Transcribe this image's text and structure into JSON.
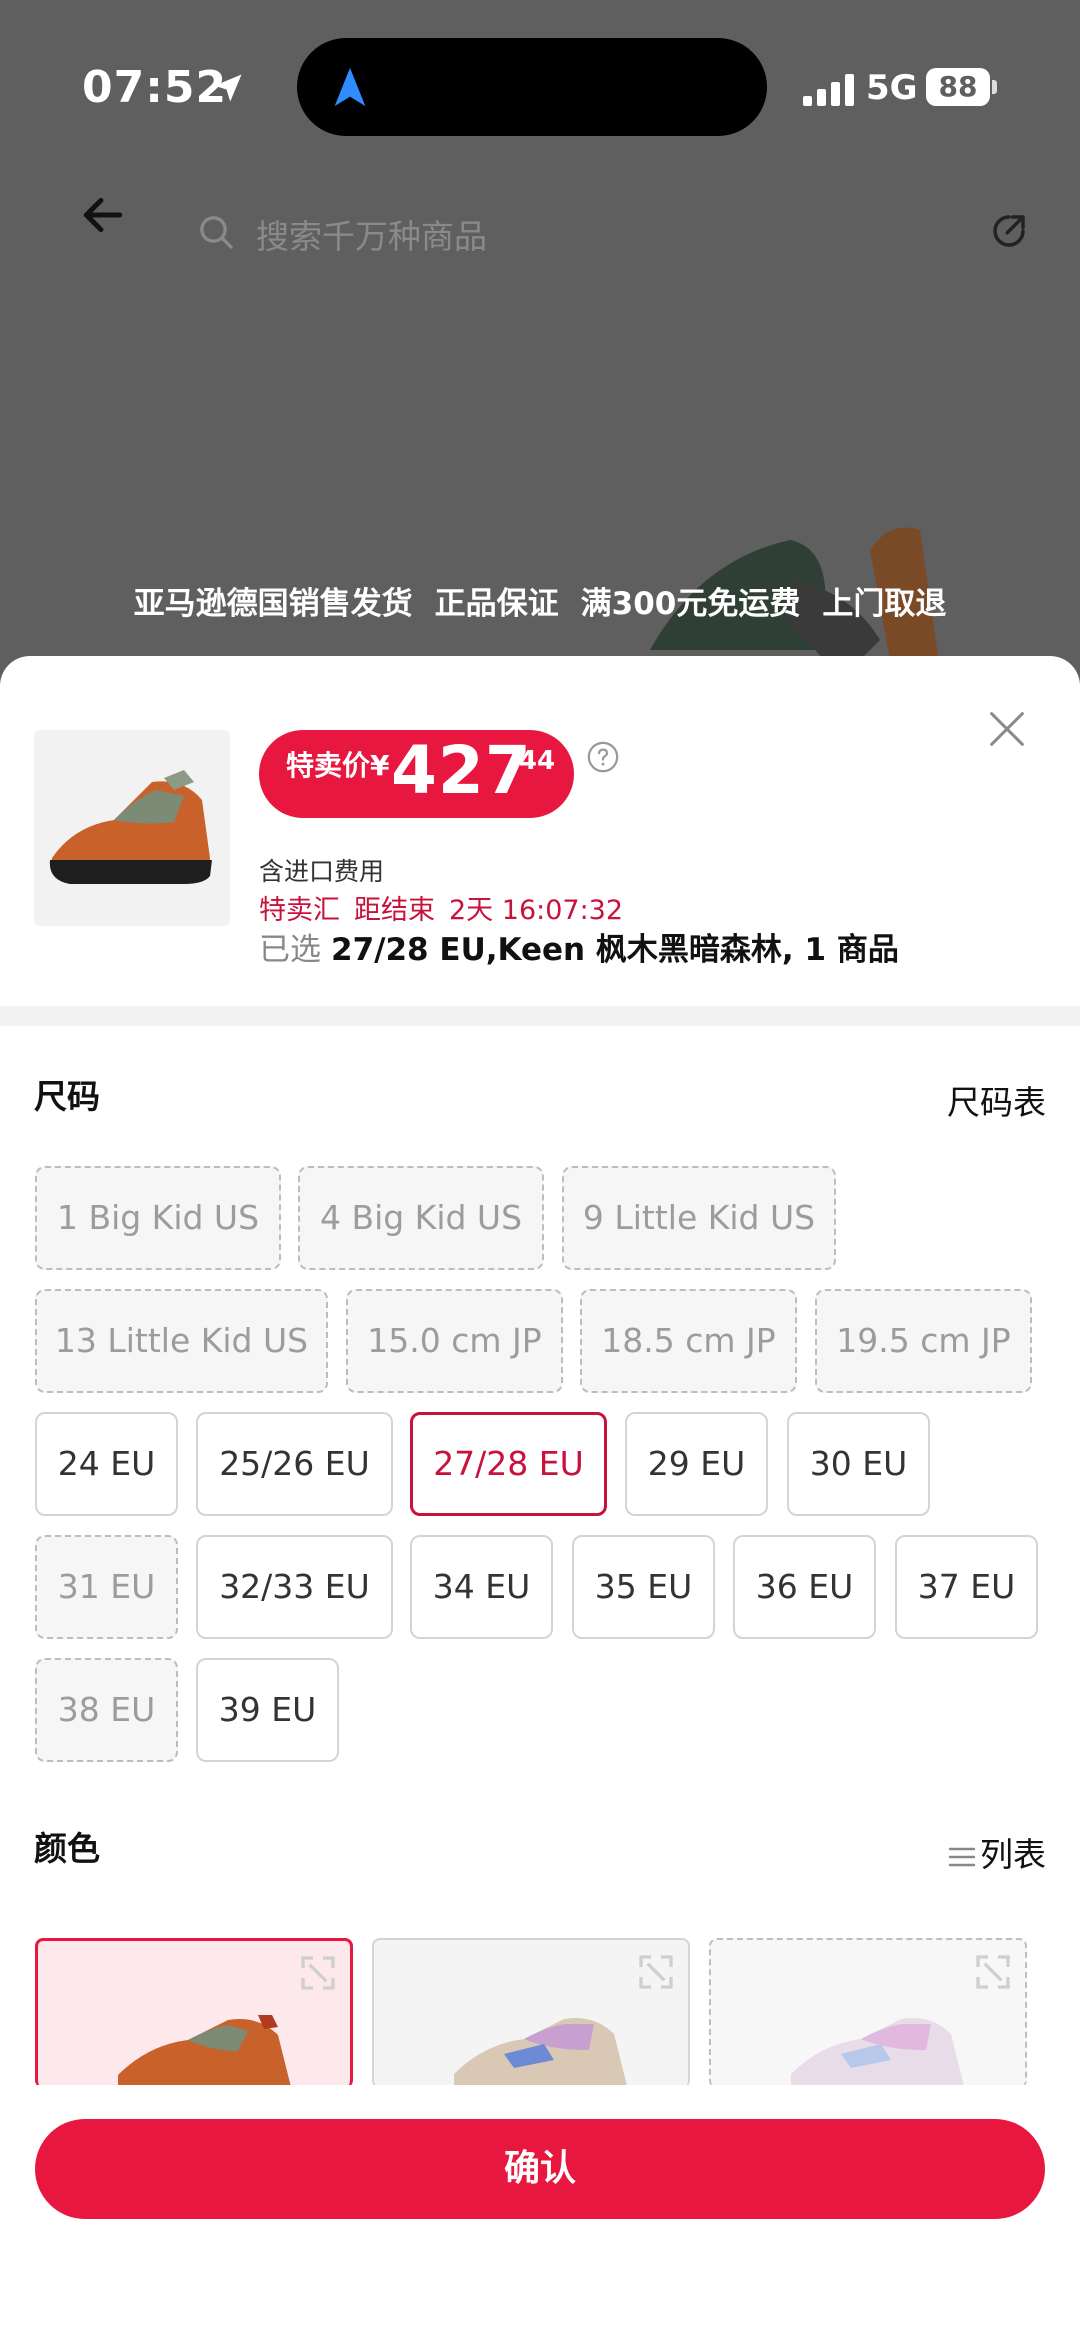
{
  "status_bar": {
    "time": "07:52",
    "network": "5G",
    "battery": "88"
  },
  "header": {
    "search_placeholder": "搜索千万种商品"
  },
  "service_badges": [
    "亚马逊德国销售发货",
    "正品保证",
    "满300元免运费",
    "上门取退"
  ],
  "product": {
    "price_label": "特卖价¥",
    "price_int": "427",
    "price_dec": ".44",
    "import_fee": "含进口费用",
    "deal_name": "特卖汇",
    "deal_countdown_label": "距结束",
    "deal_countdown": "2天 16:07:32",
    "selected_prefix": "已选",
    "selected_value": "27/28 EU,Keen 枫木黑暗森林, 1 商品"
  },
  "size_section": {
    "title": "尺码",
    "chart_link": "尺码表",
    "sizes": [
      {
        "label": "1 Big Kid US",
        "state": "unavailable"
      },
      {
        "label": "4 Big Kid US",
        "state": "unavailable"
      },
      {
        "label": "9 Little Kid US",
        "state": "unavailable"
      },
      {
        "label": "13 Little Kid US",
        "state": "unavailable"
      },
      {
        "label": "15.0 cm JP",
        "state": "unavailable"
      },
      {
        "label": "18.5 cm JP",
        "state": "unavailable"
      },
      {
        "label": "19.5 cm JP",
        "state": "unavailable"
      },
      {
        "label": "24 EU",
        "state": "available"
      },
      {
        "label": "25/26 EU",
        "state": "available"
      },
      {
        "label": "27/28 EU",
        "state": "selected"
      },
      {
        "label": "29 EU",
        "state": "available"
      },
      {
        "label": "30 EU",
        "state": "available"
      },
      {
        "label": "31 EU",
        "state": "unavailable"
      },
      {
        "label": "32/33 EU",
        "state": "available"
      },
      {
        "label": "34 EU",
        "state": "available"
      },
      {
        "label": "35 EU",
        "state": "available"
      },
      {
        "label": "36 EU",
        "state": "available"
      },
      {
        "label": "37 EU",
        "state": "available"
      },
      {
        "label": "38 EU",
        "state": "unavailable"
      },
      {
        "label": "39 EU",
        "state": "available"
      }
    ]
  },
  "color_section": {
    "title": "颜色",
    "view_toggle": "列表",
    "colors": [
      {
        "state": "selected",
        "shoe_color": "#c8622a"
      },
      {
        "state": "available",
        "shoe_color": "#c8a0d0"
      },
      {
        "state": "unavailable",
        "shoe_color": "#e0b8e0"
      }
    ]
  },
  "actions": {
    "confirm": "确认"
  },
  "colors": {
    "accent": "#e8173f",
    "accent_dark": "#c8123b"
  }
}
